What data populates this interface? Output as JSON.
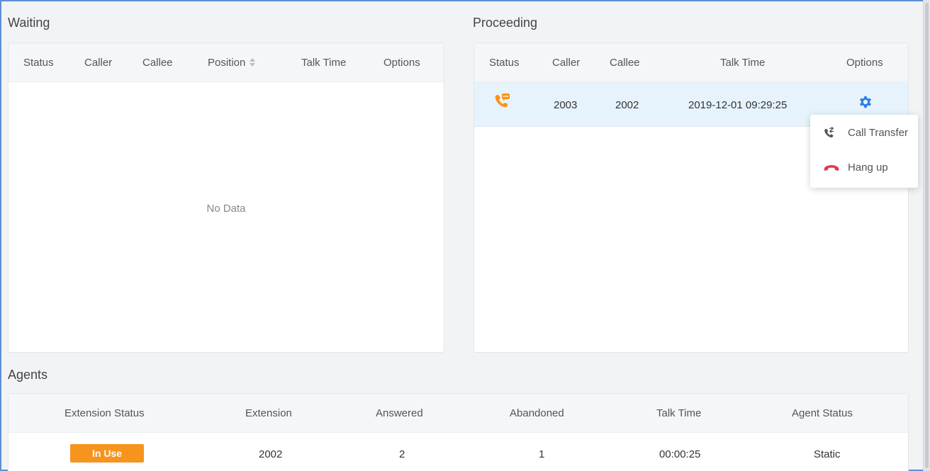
{
  "waiting": {
    "title": "Waiting",
    "columns": [
      "Status",
      "Caller",
      "Callee",
      "Position",
      "Talk Time",
      "Options"
    ],
    "empty_text": "No Data"
  },
  "proceeding": {
    "title": "Proceeding",
    "columns": [
      "Status",
      "Caller",
      "Callee",
      "Talk Time",
      "Options"
    ],
    "rows": [
      {
        "status_icon": "phone-ringing-icon",
        "caller": "2003",
        "callee": "2002",
        "talk_time": "2019-12-01 09:29:25",
        "options_icon": "gear-icon"
      }
    ],
    "options_menu": [
      {
        "label": "Call Transfer",
        "icon": "call-transfer-icon"
      },
      {
        "label": "Hang up",
        "icon": "hang-up-icon"
      }
    ]
  },
  "agents": {
    "title": "Agents",
    "columns": [
      "Extension Status",
      "Extension",
      "Answered",
      "Abandoned",
      "Talk Time",
      "Agent Status"
    ],
    "rows": [
      {
        "extension_status": "In Use",
        "extension": "2002",
        "answered": "2",
        "abandoned": "1",
        "talk_time": "00:00:25",
        "agent_status": "Static"
      }
    ]
  },
  "colors": {
    "accent_orange": "#f7941d",
    "gear_blue": "#2f7fe0",
    "hangup_red": "#e0394a",
    "selected_row": "#e6f3fc",
    "frame_border": "#5b8fd6"
  }
}
